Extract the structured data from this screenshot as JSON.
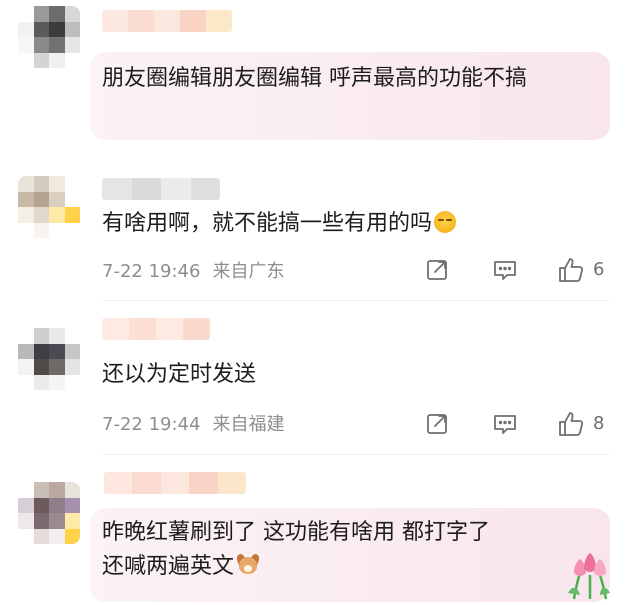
{
  "comments": [
    {
      "text": "朋友圈编辑朋友圈编辑 呼声最高的功能不搞"
    },
    {
      "text": "有啥用啊，就不能搞一些有用的吗",
      "emoji": "grinning-face-emoji",
      "date": "7-22 19:46",
      "location": "来自广东",
      "likes": "6"
    },
    {
      "text": "还以为定时发送",
      "date": "7-22 19:44",
      "location": "来自福建",
      "likes": "8"
    },
    {
      "text_line1": "昨晚红薯刷到了 这功能有啥用 都打字了",
      "text_line2": "还喊两遍英文",
      "emoji": "dog-face-emoji"
    }
  ],
  "icons": [
    "share-icon",
    "comment-icon",
    "like-icon",
    "tulip-sticker-icon"
  ],
  "colors": {
    "bubble_pink": "#f8e6ec",
    "meta_gray": "#8e8e8e",
    "text": "#1d1d1d"
  }
}
